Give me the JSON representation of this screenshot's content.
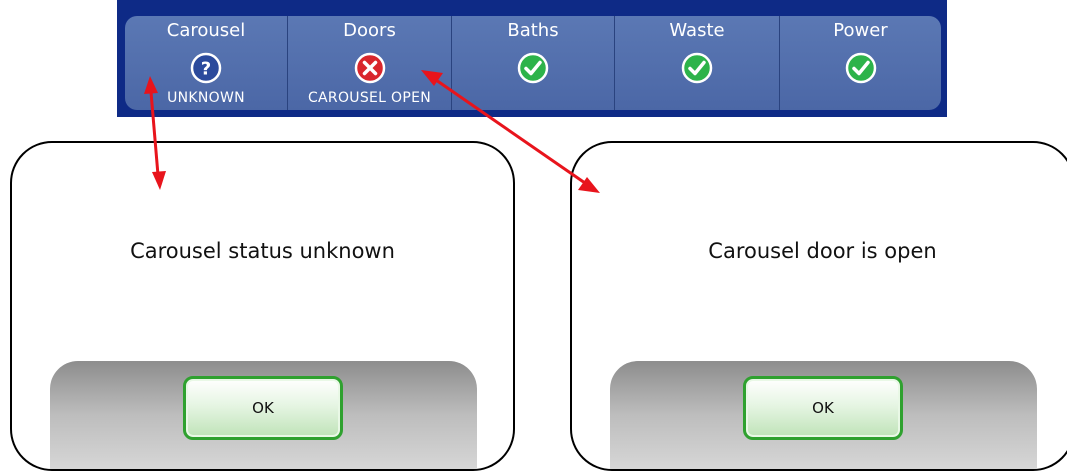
{
  "status_bar": {
    "tiles": [
      {
        "title": "Carousel",
        "icon": "question-icon",
        "status": "UNKNOWN"
      },
      {
        "title": "Doors",
        "icon": "error-x-icon",
        "status": "CAROUSEL OPEN"
      },
      {
        "title": "Baths",
        "icon": "check-icon",
        "status": ""
      },
      {
        "title": "Waste",
        "icon": "check-icon",
        "status": ""
      },
      {
        "title": "Power",
        "icon": "check-icon",
        "status": ""
      }
    ]
  },
  "dialogs": [
    {
      "message": "Carousel status unknown",
      "button_label": "OK"
    },
    {
      "message": "Carousel door is open",
      "button_label": "OK"
    }
  ],
  "colors": {
    "bar_background": "#0e2a86",
    "tile": "#5470ad",
    "ok_check": "#2db34a",
    "error": "#d9262c",
    "arrow": "#e8141c",
    "button_border": "#2fa12f"
  }
}
